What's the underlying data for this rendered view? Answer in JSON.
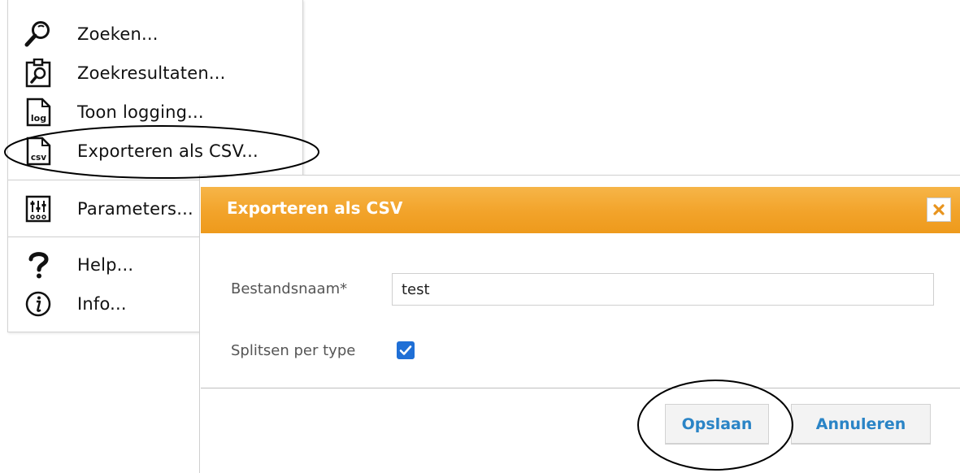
{
  "menu": {
    "items": [
      {
        "icon": "search-icon",
        "label": "Zoeken..."
      },
      {
        "icon": "search-results-icon",
        "label": "Zoekresultaten..."
      },
      {
        "icon": "log-file-icon",
        "label": "Toon logging..."
      },
      {
        "icon": "csv-file-icon",
        "label": "Exporteren als CSV..."
      },
      {
        "icon": "parameters-icon",
        "label": "Parameters..."
      },
      {
        "icon": "help-icon",
        "label": "Help..."
      },
      {
        "icon": "info-icon",
        "label": "Info..."
      }
    ],
    "log_icon_text": "log",
    "csv_icon_text": "csv"
  },
  "dialog": {
    "title": "Exporteren als CSV",
    "filename_label": "Bestandsnaam*",
    "filename_value": "test",
    "split_label": "Splitsen per type",
    "split_checked": true,
    "save_label": "Opslaan",
    "cancel_label": "Annuleren",
    "close_icon": "close-icon"
  },
  "colors": {
    "header_orange": "#f2a32a",
    "button_text_blue": "#2a84c6",
    "checkbox_blue": "#1f6fd6",
    "close_x_orange": "#e8941e"
  }
}
